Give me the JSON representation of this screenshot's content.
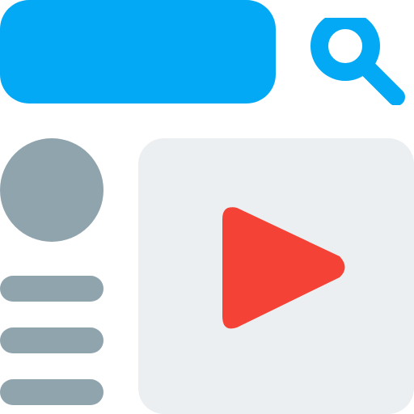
{
  "colors": {
    "accent": "#03A9F4",
    "muted": "#90A4AE",
    "panel": "#ECEFF1",
    "play": "#F44336",
    "background": "#FFFFFF"
  },
  "icons": {
    "search": "search-icon",
    "play": "play-icon",
    "avatar": "avatar-placeholder"
  }
}
